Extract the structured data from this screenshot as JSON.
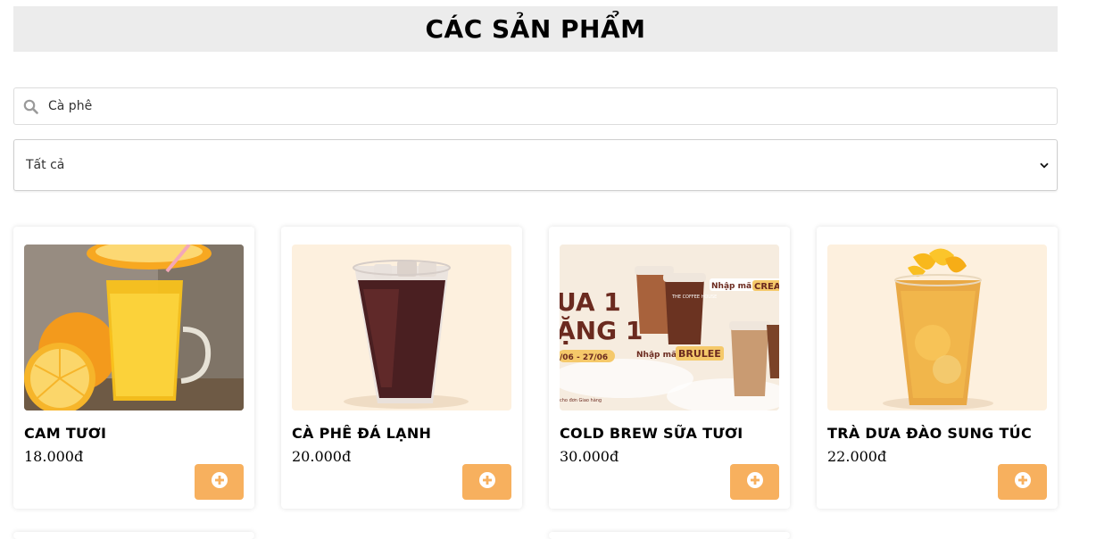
{
  "page": {
    "title": "CÁC SẢN PHẨM"
  },
  "search": {
    "value": "Cà phê",
    "icon": "search-icon"
  },
  "filter": {
    "selected": "Tất cả",
    "icon": "chevron-down-icon"
  },
  "colors": {
    "title_bg": "#ececec",
    "add_button": "#f7b05e"
  },
  "products": [
    {
      "name": "CAM TƯƠI",
      "price": "18.000đ",
      "image": "orange-juice"
    },
    {
      "name": "CÀ PHÊ ĐÁ LẠNH",
      "price": "20.000đ",
      "image": "iced-coffee"
    },
    {
      "name": "COLD BREW SỮA TƯƠI",
      "price": "30.000đ",
      "image": "cold-brew-promo-banner"
    },
    {
      "name": "TRÀ DƯA ĐÀO SUNG TÚC",
      "price": "22.000đ",
      "image": "peach-tea"
    }
  ],
  "promo_banner": {
    "line1": "UA 1",
    "line2": "ẶNG 1",
    "code1_label": "Nhập mã:",
    "code1": "CREA",
    "code2_label": "Nhập mã:",
    "code2": "BRULEE",
    "dates": "/06 - 27/06",
    "brand": "THE COFFEE HOUSE",
    "footnote": "cho đơn Giao hàng"
  }
}
